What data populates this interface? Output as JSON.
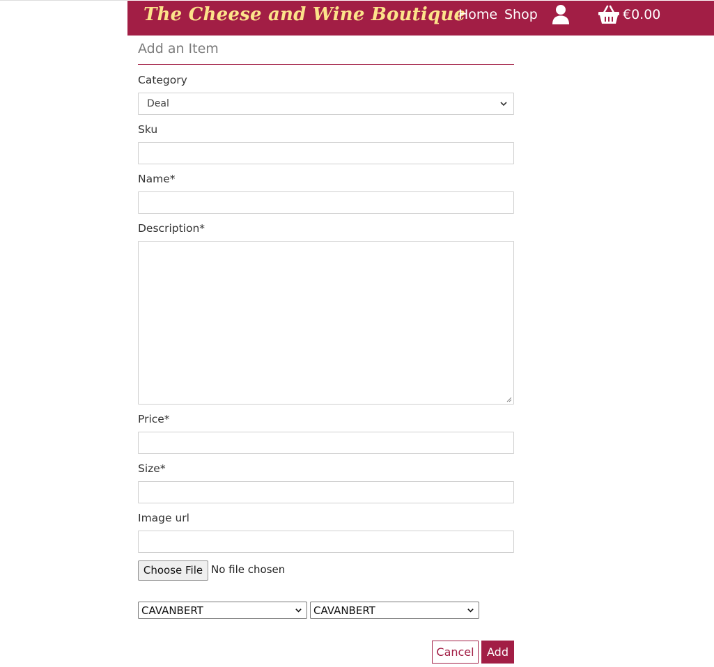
{
  "header": {
    "brand": "The Cheese and Wine Boutique",
    "nav_home": "Home",
    "nav_shop": "Shop",
    "account_icon": "user-icon",
    "cart_icon": "basket-icon",
    "cart_total": "€0.00"
  },
  "form": {
    "title": "Add an Item",
    "category_label": "Category",
    "category_value": "Deal",
    "sku_label": "Sku",
    "name_label": "Name*",
    "description_label": "Description*",
    "price_label": "Price*",
    "size_label": "Size*",
    "image_url_label": "Image url",
    "file_button": "Choose File",
    "file_status": "No file chosen",
    "select_1_value": "CAVANBERT",
    "select_2_value": "CAVANBERT",
    "cancel_label": "Cancel",
    "add_label": "Add"
  },
  "colors": {
    "brand": "#a21e45",
    "brand_text": "#fce38a"
  }
}
